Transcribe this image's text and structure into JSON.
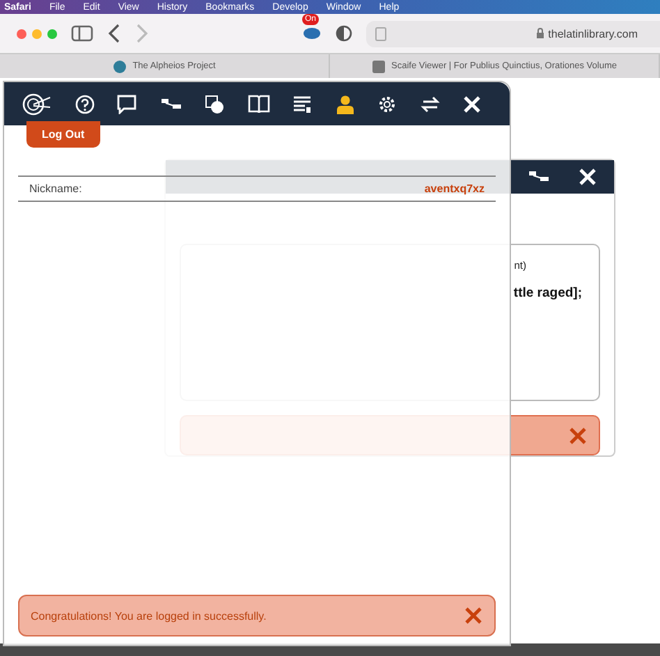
{
  "menubar": {
    "items": [
      "Safari",
      "File",
      "Edit",
      "View",
      "History",
      "Bookmarks",
      "Develop",
      "Window",
      "Help"
    ]
  },
  "browser": {
    "extension_badge": "On",
    "address": "thelatinlibrary.com",
    "tabs": [
      {
        "label": "The Alpheios Project",
        "selected": false
      },
      {
        "label": "Scaife Viewer | For Publius Quinctius, Orationes Volume",
        "selected": false
      }
    ]
  },
  "back_panel": {
    "line_end": "nt)",
    "definition": "ttle raged];"
  },
  "front_panel": {
    "toolbar": [
      {
        "kind": "logo",
        "selected": false
      },
      {
        "kind": "help",
        "selected": false
      },
      {
        "kind": "chat",
        "selected": false
      },
      {
        "kind": "tree",
        "selected": false
      },
      {
        "kind": "stack",
        "selected": false
      },
      {
        "kind": "book",
        "selected": false
      },
      {
        "kind": "list",
        "selected": false
      },
      {
        "kind": "user",
        "selected": true
      },
      {
        "kind": "settings",
        "selected": false
      },
      {
        "kind": "swap",
        "selected": false
      },
      {
        "kind": "close",
        "selected": false
      }
    ],
    "logout": "Log Out",
    "nickname_label": "Nickname:",
    "nickname": "aventxq7xz",
    "alert": "Congratulations! You are logged in successfully."
  }
}
